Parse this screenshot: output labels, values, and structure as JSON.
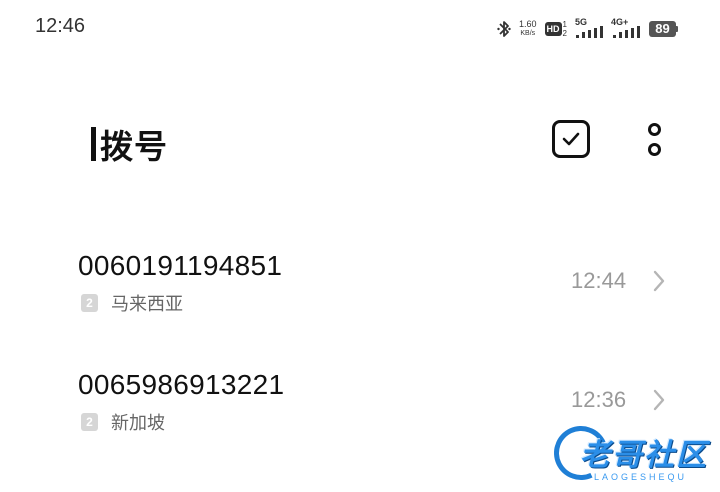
{
  "status_bar": {
    "time": "12:46",
    "net_speed_value": "1.60",
    "net_speed_unit": "KB/s",
    "hd_label": "HD",
    "hd_top": "1",
    "hd_bottom": "2",
    "signal1_tech": "5G",
    "signal2_tech": "4G+",
    "battery_level": "89"
  },
  "header": {
    "title": "拨号",
    "icons": [
      "select-check-icon",
      "more-options-icon"
    ]
  },
  "calls": [
    {
      "number": "0060191194851",
      "sim": "2",
      "location": "马来西亚",
      "time": "12:44"
    },
    {
      "number": "0065986913221",
      "sim": "2",
      "location": "新加坡",
      "time": "12:36"
    }
  ],
  "watermark": {
    "text": "老哥社区",
    "sub": "LAOGESHEQU"
  }
}
